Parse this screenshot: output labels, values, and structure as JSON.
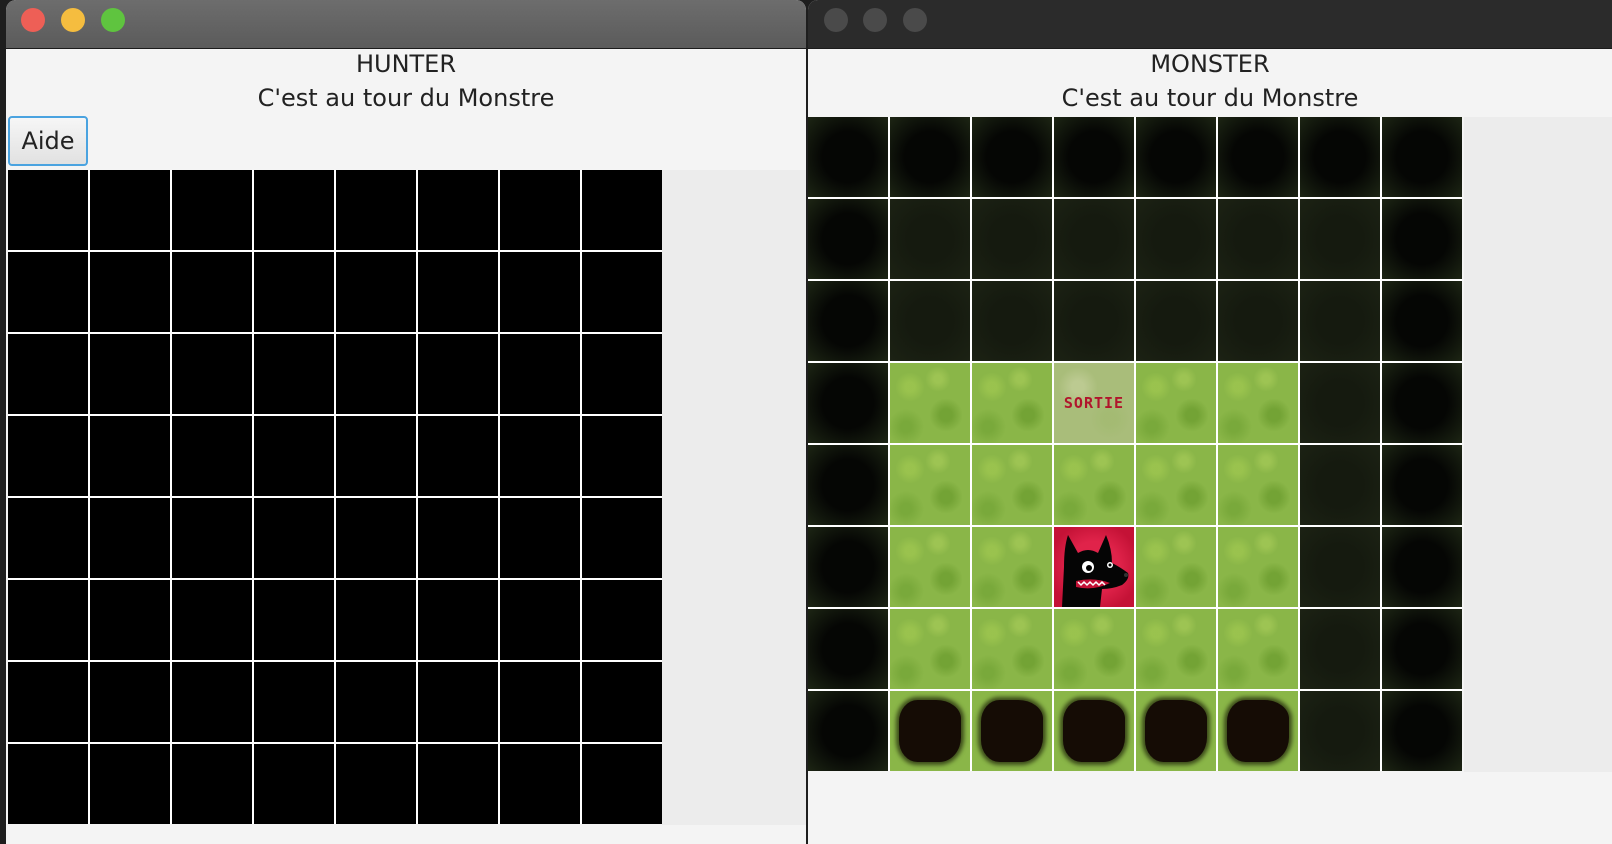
{
  "hunter_window": {
    "role_title": "HUNTER",
    "turn_status": "C'est au tour du Monstre",
    "help_button_label": "Aide",
    "grid": {
      "rows": 8,
      "cols": 8,
      "state": "all cells unrevealed"
    }
  },
  "monster_window": {
    "role_title": "MONSTER",
    "turn_status": "C'est au tour du Monstre",
    "exit_label": "SORTIE",
    "grid": {
      "rows": 8,
      "cols": 8,
      "legend": {
        "W": "wall",
        "D": "dark",
        "G": "grass",
        "S": "exit",
        "M": "monster",
        "P": "pit"
      },
      "map": [
        "WWWWWWWW",
        "WDDDDDDW",
        "WDDDDDDW",
        "WGGSGGDW",
        "WGGGGGDW",
        "WGGMGGDW",
        "WGGGGGDW",
        "WPPPPPDW"
      ]
    }
  },
  "colors": {
    "close": "#ee5f56",
    "minimize": "#f5bd3f",
    "zoom": "#5fc43f",
    "grass": "#8ab648",
    "monster_bg": "#e0234a",
    "exit_text": "#b0152c"
  }
}
